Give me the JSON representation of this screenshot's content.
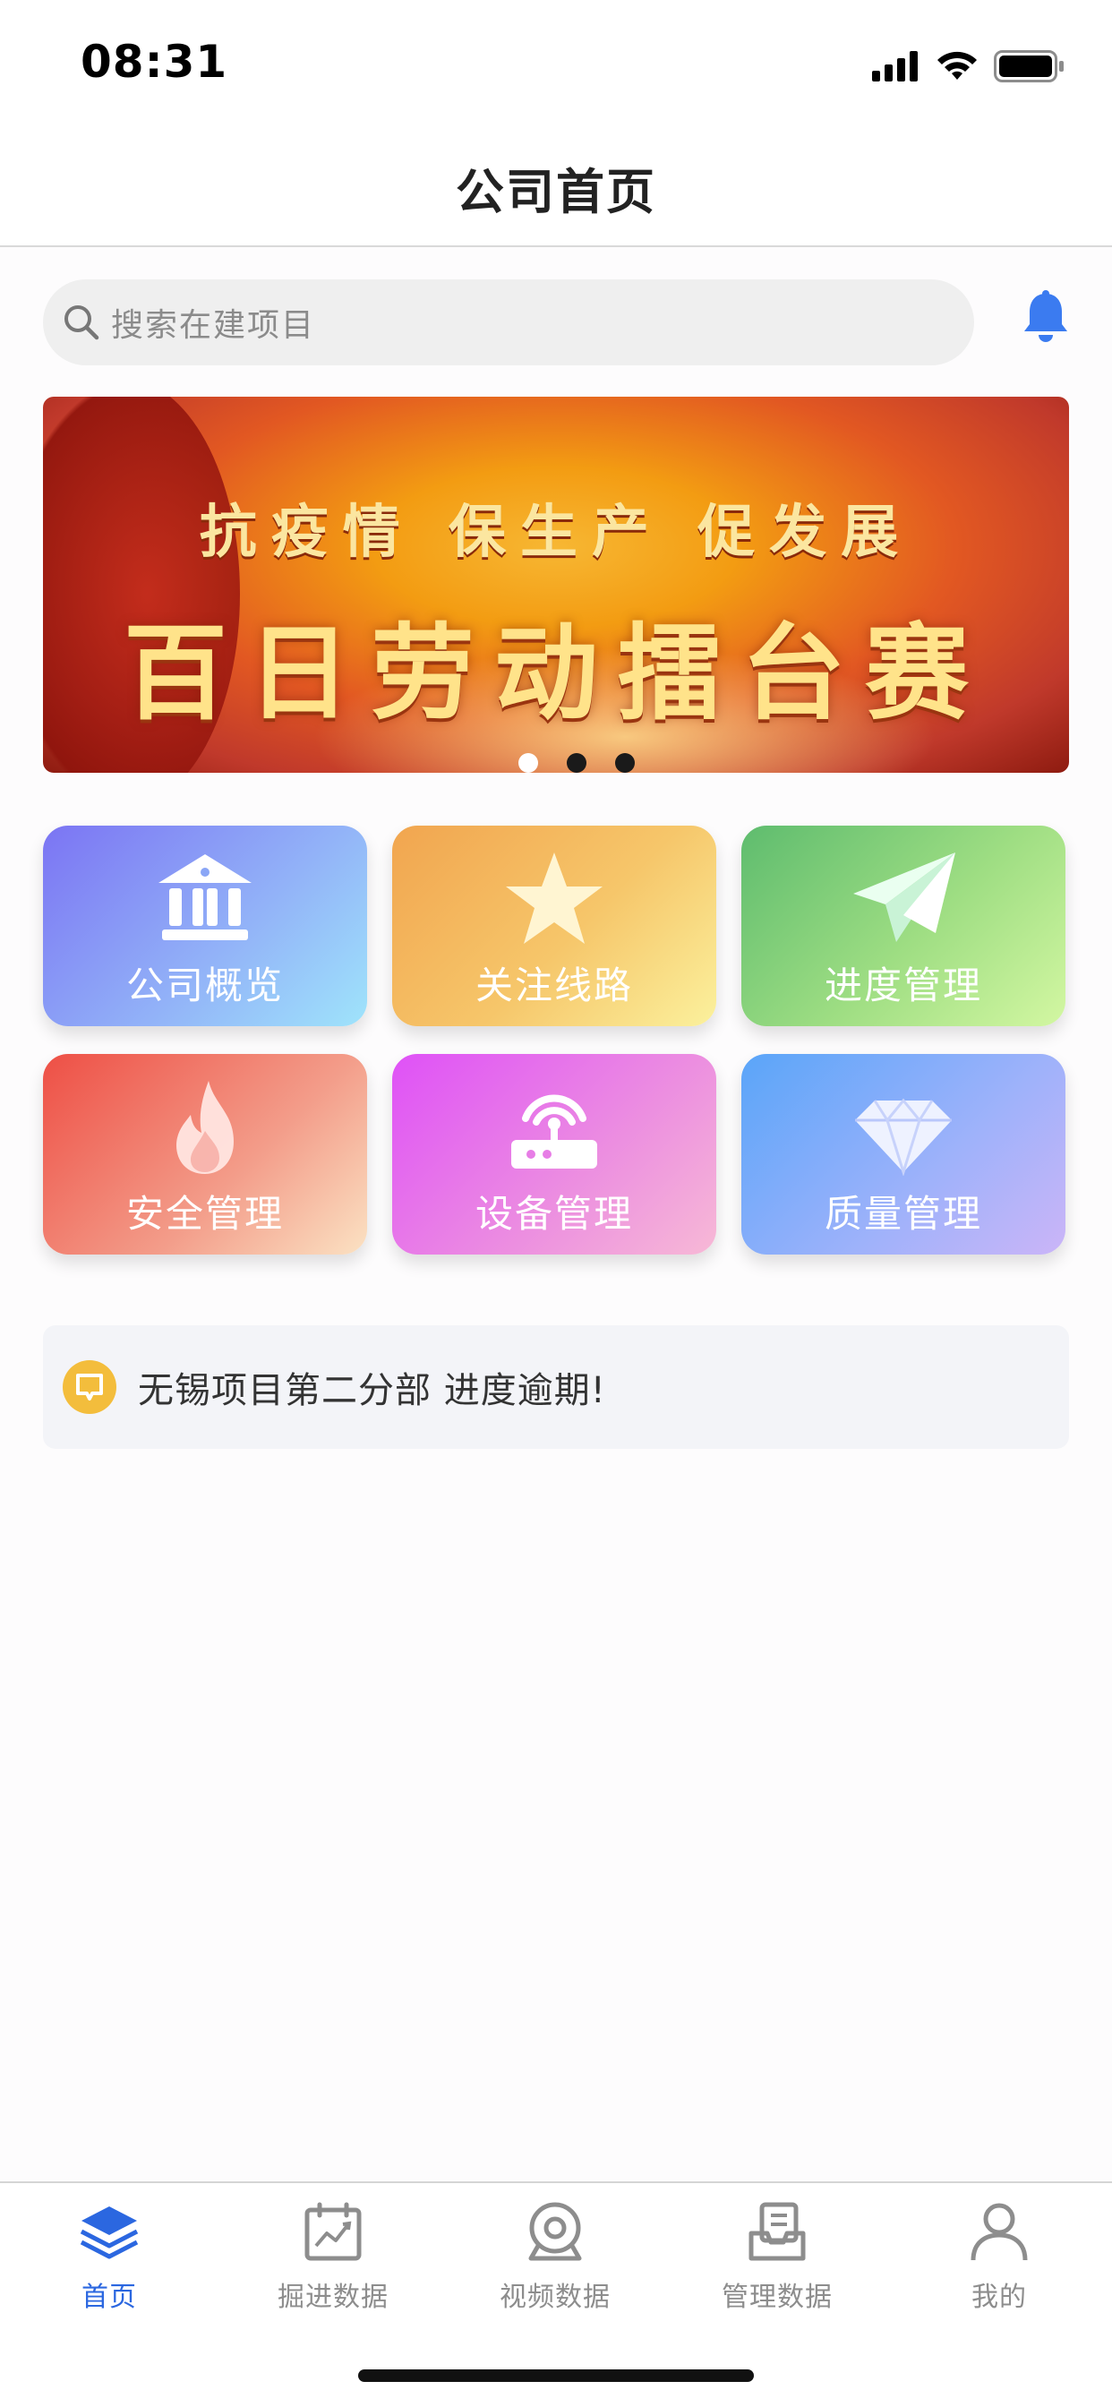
{
  "status_bar": {
    "time": "08:31"
  },
  "header": {
    "title": "公司首页"
  },
  "search": {
    "placeholder": "搜索在建项目"
  },
  "banner": {
    "line1": "抗疫情 保生产 促发展",
    "line2": "百日劳动擂台赛",
    "dots": 3,
    "active_dot": 0
  },
  "tiles": [
    {
      "label": "公司概览",
      "icon": "bank-icon"
    },
    {
      "label": "关注线路",
      "icon": "star-icon"
    },
    {
      "label": "进度管理",
      "icon": "paper-plane-icon"
    },
    {
      "label": "安全管理",
      "icon": "flame-icon"
    },
    {
      "label": "设备管理",
      "icon": "router-icon"
    },
    {
      "label": "质量管理",
      "icon": "diamond-icon"
    }
  ],
  "notice": {
    "text": "无锡项目第二分部 进度逾期!"
  },
  "tabs": [
    {
      "label": "首页",
      "icon": "layers-icon",
      "active": true
    },
    {
      "label": "掘进数据",
      "icon": "chart-calendar-icon",
      "active": false
    },
    {
      "label": "视频数据",
      "icon": "camera-icon",
      "active": false
    },
    {
      "label": "管理数据",
      "icon": "document-stack-icon",
      "active": false
    },
    {
      "label": "我的",
      "icon": "user-icon",
      "active": false
    }
  ],
  "colors": {
    "accent": "#2b67e0",
    "bell": "#3b7bf0",
    "notice_icon": "#f3bd3c"
  }
}
